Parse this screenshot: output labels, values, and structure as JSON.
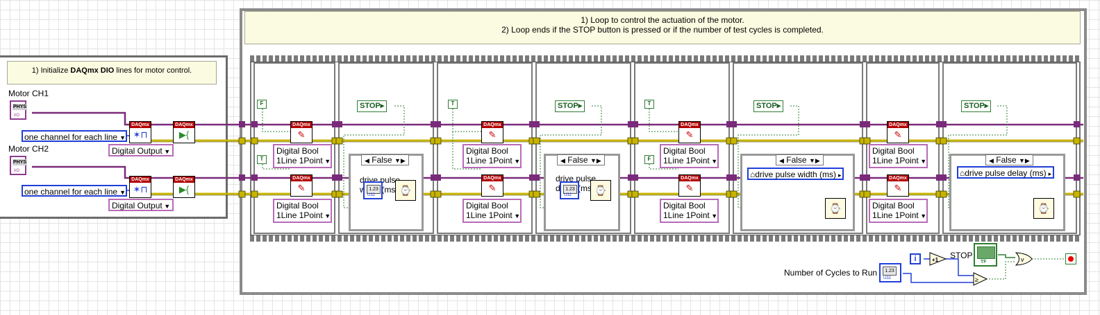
{
  "init_comment": {
    "prefix": "1) Initialize ",
    "bold": "DAQmx DIO",
    "suffix": " lines for motor control."
  },
  "loop_comment": {
    "line1": "1) Loop to control the actuation of the motor.",
    "line2": "2) Loop ends if the STOP button is pressed or if the number of test cycles is completed."
  },
  "channels": {
    "ch1_label": "Motor CH1",
    "ch2_label": "Motor CH2",
    "phys_text": "PHYS",
    "io_text": "I/O",
    "line_grouping": "one channel for each line",
    "output_type": "Digital Output"
  },
  "daqmx_text": "DAQmx",
  "write_type": {
    "line1": "Digital Bool",
    "line2": "1Line 1Point"
  },
  "bool_true": "T",
  "bool_false": "F",
  "stop_const": "STOP",
  "case_false": "False",
  "frames": {
    "frame2_label": "drive pulse width (ms)",
    "frame4_label": "drive pulse delay (ms)",
    "frame6_local": "drive pulse width (ms)",
    "frame8_local": "drive pulse  delay (ms)"
  },
  "numeric_text": "1.23",
  "footer": {
    "stop_label": "STOP",
    "tf_text": "TF",
    "cycles_label": "Number of Cycles to Run",
    "iteration": "i",
    "increment": "+1"
  },
  "colors": {
    "wire_daq": "#7a2a7a",
    "wire_error": "#c8b400",
    "wire_bool": "#2e7d32",
    "wire_numeric": "#1f3fd6",
    "loop_frame": "#8a8a8a",
    "comment_bg": "#fbfbe1"
  }
}
